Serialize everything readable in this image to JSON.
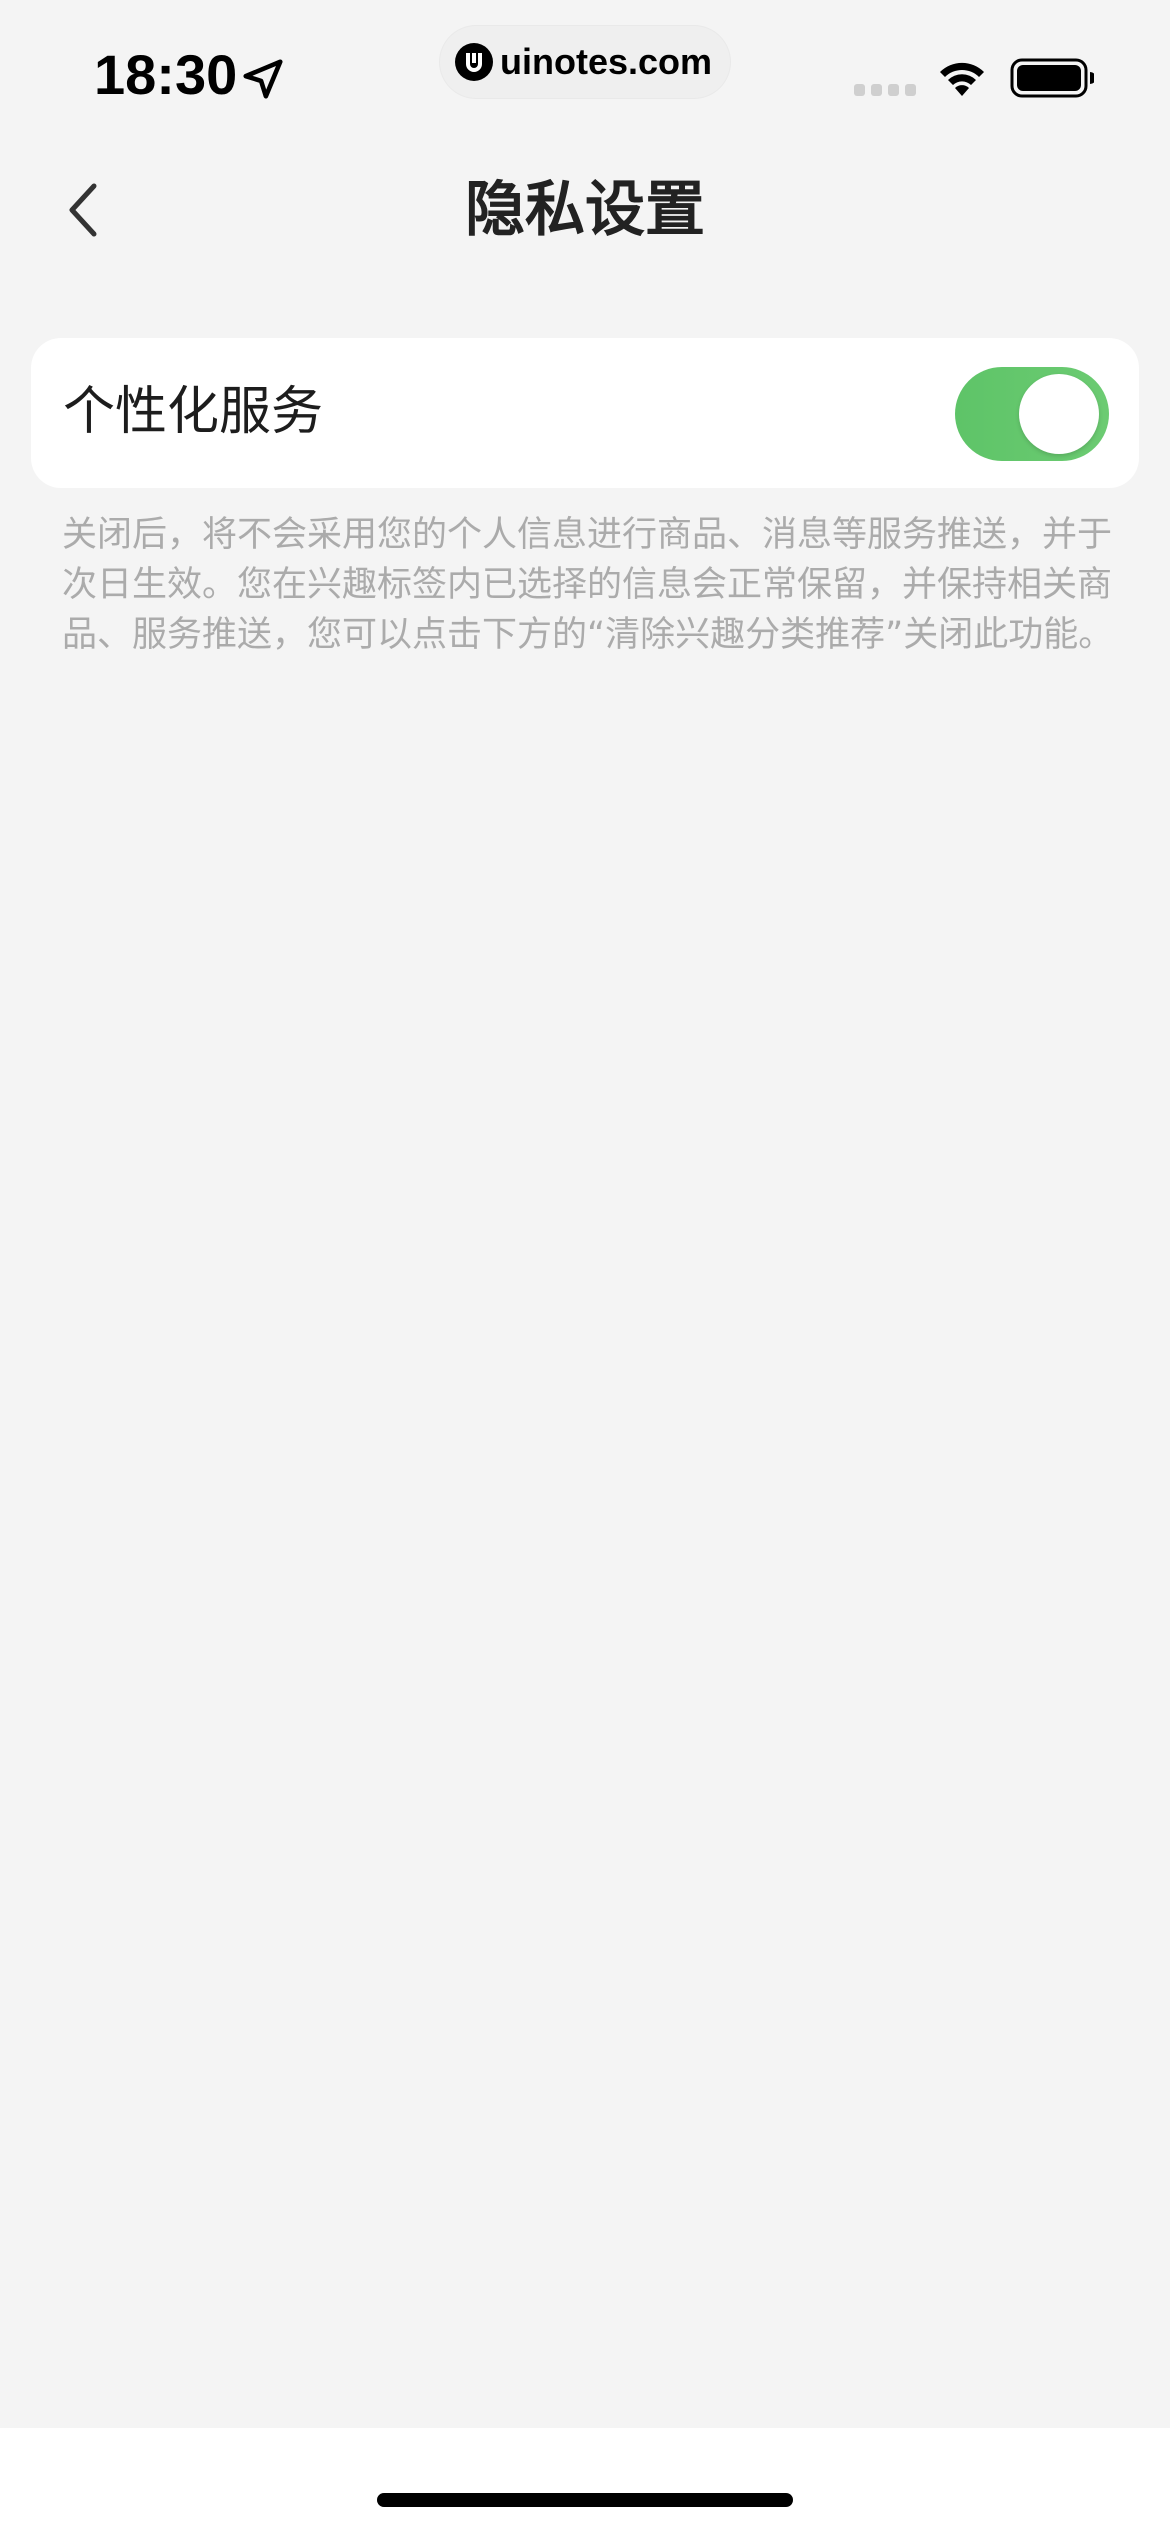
{
  "status_bar": {
    "time": "18:30",
    "url": "uinotes.com",
    "icons": [
      "location-arrow-icon",
      "site-logo-icon",
      "signal-icon",
      "wifi-icon",
      "battery-icon"
    ]
  },
  "nav": {
    "title": "隐私设置",
    "back_icon": "chevron-left-icon"
  },
  "settings": {
    "personalized_service": {
      "label": "个性化服务",
      "enabled": true
    }
  },
  "description": "关闭后，将不会采用您的个人信息进行商品、消息等服务推送，并于次日生效。您在兴趣标签内已选择的信息会正常保留，并保持相关商品、服务推送，您可以点击下方的“清除兴趣分类推荐”关闭此功能。",
  "colors": {
    "background": "#f4f4f4",
    "card": "#ffffff",
    "toggle_on": "#64c86c",
    "description_text": "#ababab"
  }
}
